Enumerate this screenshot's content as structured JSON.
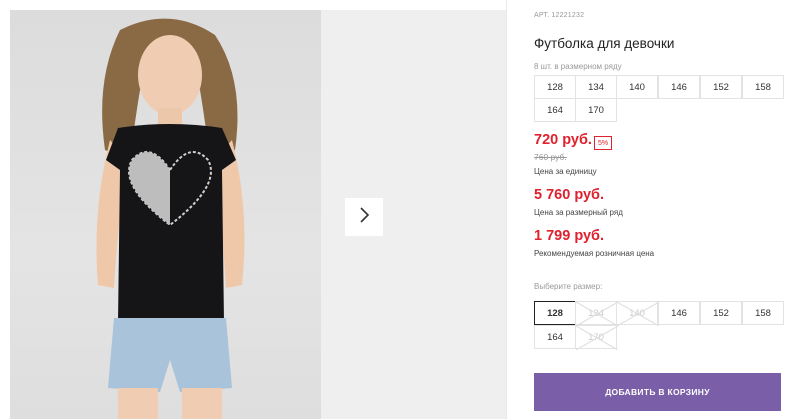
{
  "product": {
    "sku": "АРТ. 12221232",
    "title": "Футболка для девочки"
  },
  "size_range": {
    "hint": "8 шт. в размерном ряду",
    "sizes": [
      "128",
      "134",
      "140",
      "146",
      "152",
      "158",
      "164",
      "170"
    ]
  },
  "pricing": {
    "unit_price": "720 руб.",
    "discount_badge": "5%",
    "old_price": "760 руб.",
    "unit_label": "Цена за единицу",
    "set_price": "5 760 руб.",
    "set_label": "Цена за размерный ряд",
    "retail_price": "1 799 руб.",
    "retail_label": "Рекомендуемая розничная цена"
  },
  "size_select": {
    "label": "Выберите размер:",
    "options": [
      {
        "label": "128",
        "state": "selected"
      },
      {
        "label": "134",
        "state": "disabled"
      },
      {
        "label": "140",
        "state": "disabled"
      },
      {
        "label": "146",
        "state": "available"
      },
      {
        "label": "152",
        "state": "available"
      },
      {
        "label": "158",
        "state": "available"
      },
      {
        "label": "164",
        "state": "available"
      },
      {
        "label": "170",
        "state": "disabled"
      }
    ]
  },
  "cart": {
    "button_label": "ДОБАВИТЬ В КОРЗИНУ"
  },
  "colors": {
    "accent_price": "#e0212e",
    "cart_button": "#7a5ea8"
  },
  "icons": {
    "next": "chevron-right-icon"
  }
}
